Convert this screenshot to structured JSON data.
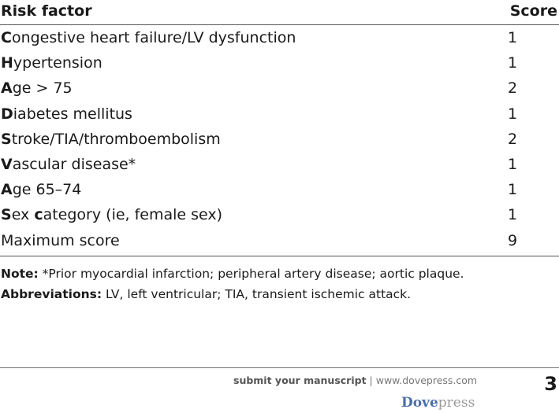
{
  "table": {
    "header": {
      "factor": "Risk factor",
      "score": "Score"
    },
    "rows": [
      {
        "initial": "C",
        "rest": "ongestive heart failure/LV dysfunction",
        "score": "1"
      },
      {
        "initial": "H",
        "rest": "ypertension",
        "score": "1"
      },
      {
        "initial": "A",
        "rest": "ge > 75",
        "score": "2"
      },
      {
        "initial": "D",
        "rest": "iabetes mellitus",
        "score": "1"
      },
      {
        "initial": "S",
        "rest": "troke/TIA/thromboembolism",
        "score": "2"
      },
      {
        "initial": "V",
        "rest": "ascular disease*",
        "score": "1"
      },
      {
        "initial": "A",
        "rest": "ge 65–74",
        "score": "1"
      },
      {
        "initial": "S",
        "rest": "ex ",
        "initial2": "c",
        "rest2": "ategory (ie, female sex)",
        "score": "1"
      },
      {
        "initial": "",
        "rest": "Maximum score",
        "score": "9"
      }
    ]
  },
  "notes": {
    "note_label": "Note:",
    "note_text": " *Prior myocardial infarction; peripheral artery disease; aortic plaque.",
    "abbr_label": "Abbreviations:",
    "abbr_text": " LV, left ventricular; TIA, transient ischemic attack."
  },
  "footer": {
    "submit_label": "submit your manuscript",
    "separator": " | ",
    "url": "www.dovepress.com",
    "page_number": "3",
    "logo_dove": "Dove",
    "logo_press": "press"
  }
}
